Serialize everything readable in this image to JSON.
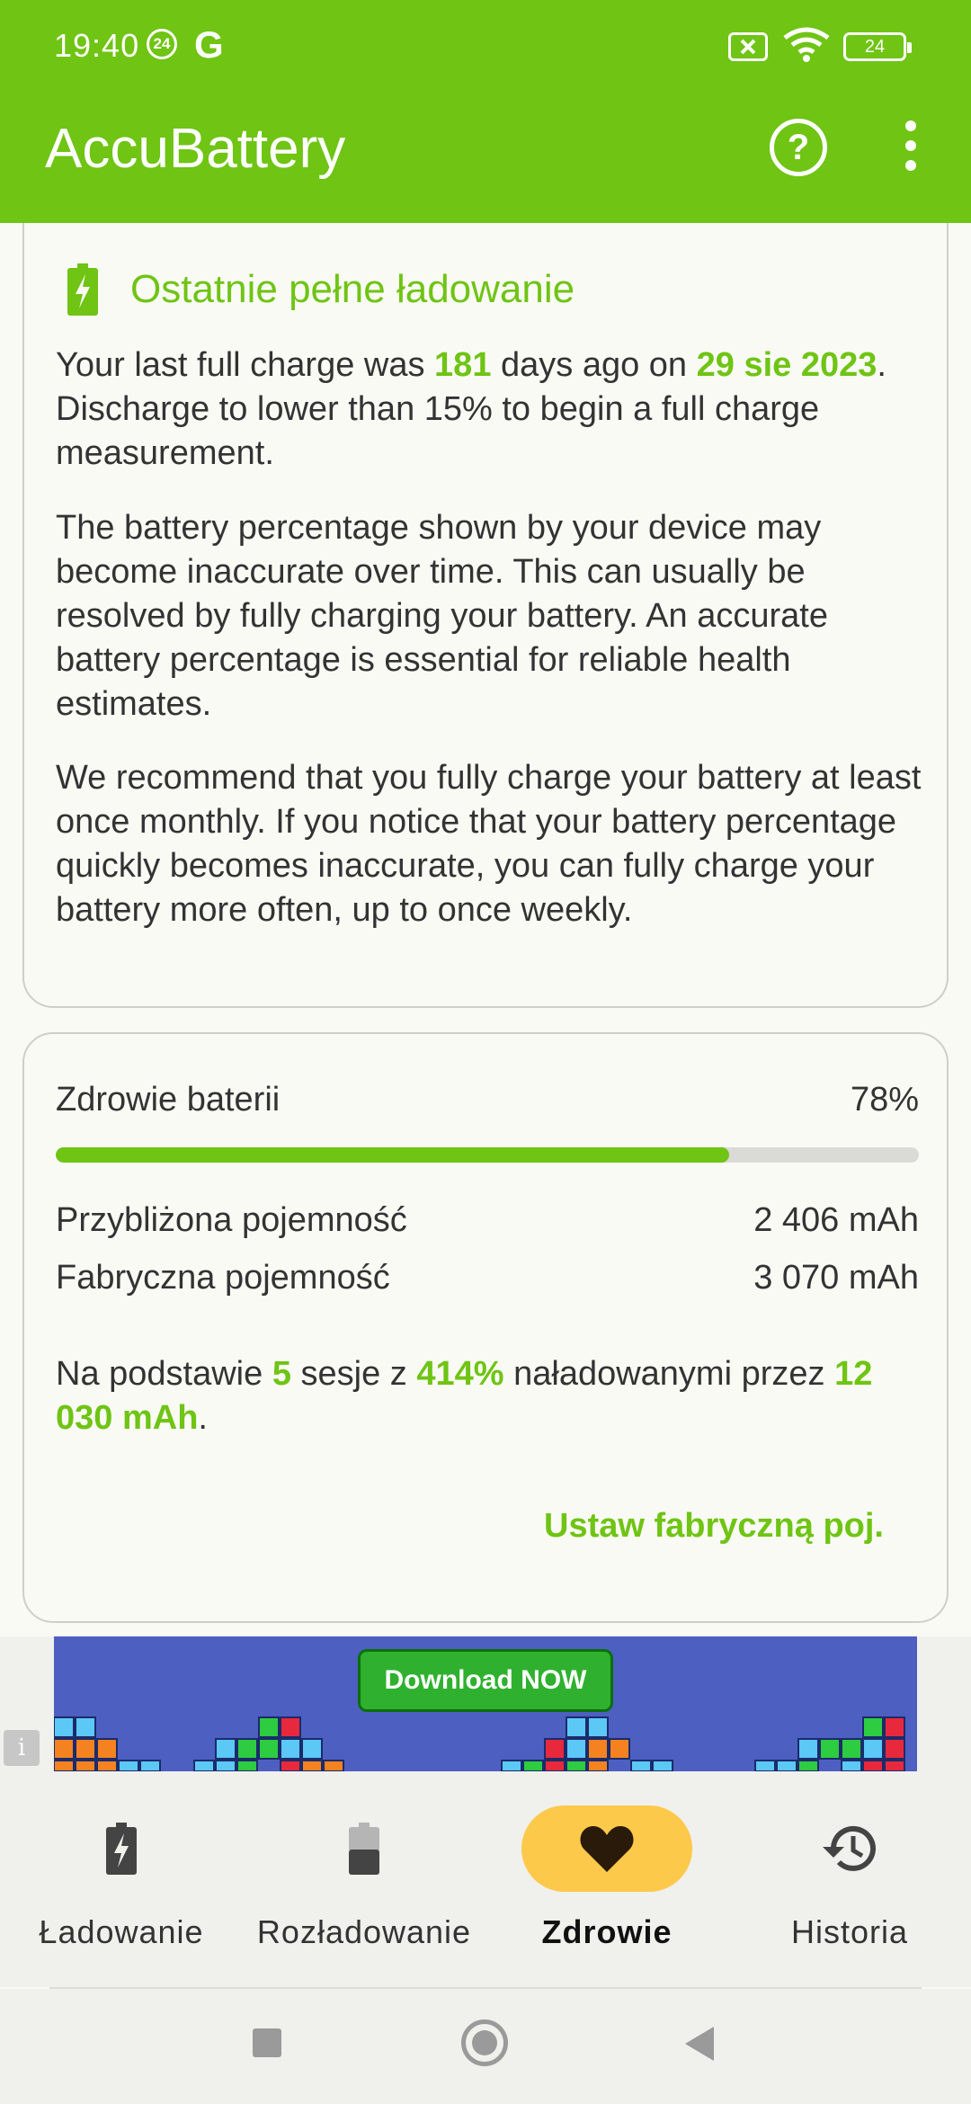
{
  "status_bar": {
    "time": "19:40",
    "notification_badge": "24",
    "google_icon": "G",
    "battery_level": "24"
  },
  "toolbar": {
    "title": "AccuBattery",
    "help_icon": "help-circle-icon",
    "more_icon": "more-vert-icon"
  },
  "last_full_charge_card": {
    "title": "Ostatnie pełne ładowanie",
    "p1_pre": "Your last full charge was ",
    "p1_days": "181",
    "p1_mid": " days ago on ",
    "p1_date": "29 sie 2023",
    "p1_post": ". Discharge to lower than 15% to begin a full charge measurement.",
    "p2": "The battery percentage shown by your device may become inaccurate over time. This can usually be resolved by fully charging your battery. An accurate battery percentage is essential for reliable health estimates.",
    "p3": "We recommend that you fully charge your battery at least once monthly. If you notice that your battery percentage quickly becomes inaccurate, you can fully charge your battery more often, up to once weekly."
  },
  "health_card": {
    "health_label": "Zdrowie baterii",
    "health_value": "78%",
    "health_fraction": 0.78,
    "approx_label": "Przybliżona pojemność",
    "approx_value": "2 406 mAh",
    "factory_label": "Fabryczna pojemność",
    "factory_value": "3 070 mAh",
    "basis_pre": "Na podstawie ",
    "basis_sessions": "5",
    "basis_mid1": " sesje z ",
    "basis_percent": "414%",
    "basis_mid2": " naładowanymi przez ",
    "basis_mah": "12 030 mAh",
    "basis_post": ".",
    "set_button": "Ustaw fabryczną poj."
  },
  "ad": {
    "button": "Download NOW",
    "info_icon": "i"
  },
  "bottom_nav": [
    {
      "label": "Ładowanie",
      "icon": "battery-charging-icon"
    },
    {
      "label": "Rozładowanie",
      "icon": "battery-discharge-icon"
    },
    {
      "label": "Zdrowie",
      "icon": "heart-icon",
      "active": true
    },
    {
      "label": "Historia",
      "icon": "history-icon"
    }
  ],
  "colors": {
    "accent": "#6fc414",
    "active_pill": "#fdc94a",
    "background": "#fafaf5"
  }
}
